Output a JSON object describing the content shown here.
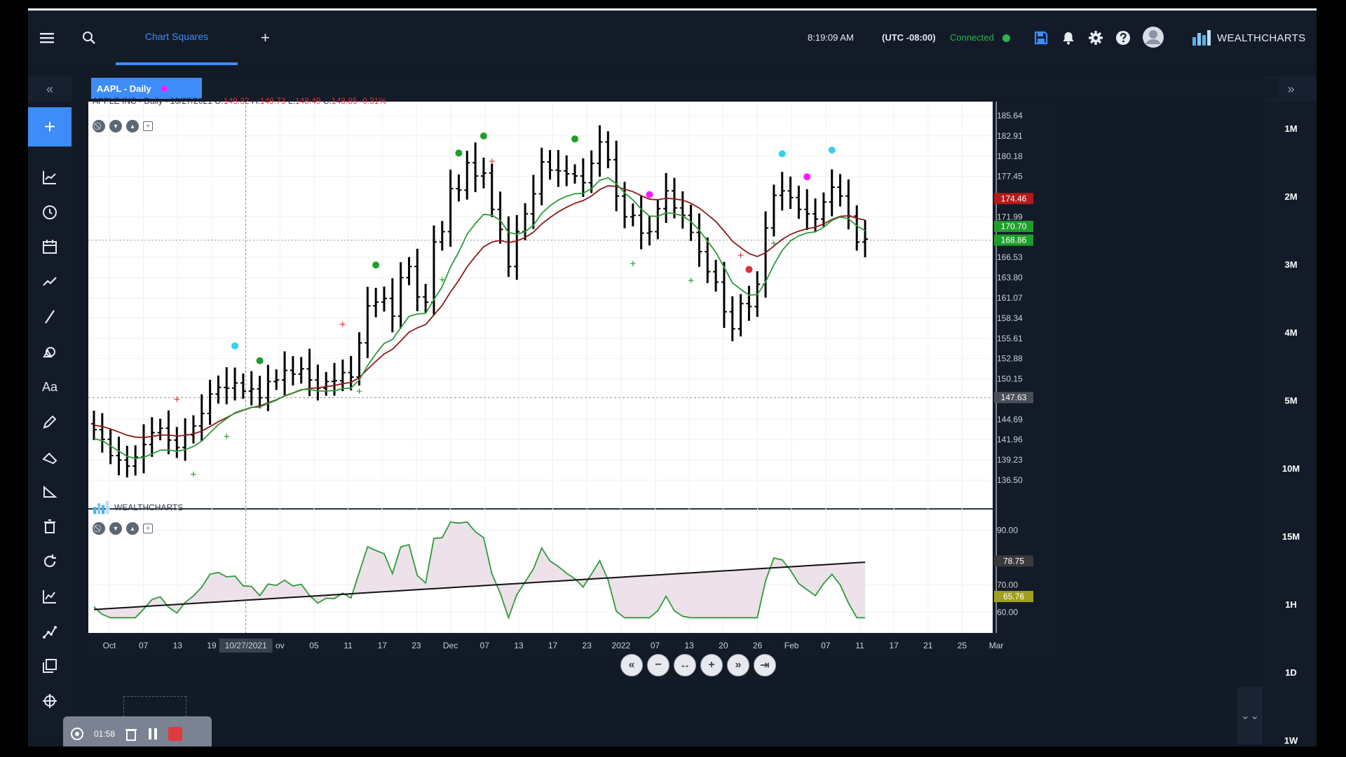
{
  "topbar": {
    "tab_label": "Chart Squares",
    "add_tab": "+",
    "time": "8:19:09 AM",
    "timezone": "(UTC -08:00)",
    "connection": "Connected",
    "brand": "WEALTHCHARTS"
  },
  "chart": {
    "symbol_tab": "AAPL - Daily",
    "ohlc": {
      "title": "APPLE INC - Daily - 10/27/2021",
      "o_label": "O:",
      "o": "149.32",
      "h_label": "H:",
      "h": "149.73",
      "l_label": "L:",
      "l": "148.49",
      "c_label": "C:",
      "c": "148.85",
      "change": "-0.31%"
    },
    "watermark": "WEALTHCHARTS",
    "crosshair_date": "10/27/2021",
    "colors": {
      "up_line": "#2e9b3a",
      "down_line": "#8b1a1a",
      "bars": "#000000",
      "price_box_red": "#b31b1b",
      "price_box_green": "#1f9e2b",
      "indicator_fill": "#e8d9e5",
      "indicator_neg_fill": "#f7c9cf"
    }
  },
  "chart_data": [
    {
      "type": "ohlc",
      "symbol": "AAPL",
      "price_axis_ticks": [
        "185.64",
        "182.91",
        "180.18",
        "177.45",
        "171.99",
        "166.53",
        "163.80",
        "161.07",
        "158.34",
        "155.61",
        "152.88",
        "150.15",
        "144.69",
        "141.96",
        "139.23",
        "136.50"
      ],
      "ylim": [
        136.5,
        185.64
      ],
      "price_labels": [
        {
          "value": "174.46",
          "color": "#b31b1b"
        },
        {
          "value": "170.70",
          "color": "#1f9e2b"
        },
        {
          "value": "168.86",
          "color": "#1f9e2b"
        },
        {
          "value": "147.63",
          "color": "#4a4f5a"
        }
      ],
      "x_ticks": [
        "Oct",
        "07",
        "13",
        "19",
        "10/27/2021",
        "ov",
        "05",
        "11",
        "17",
        "23",
        "Dec",
        "07",
        "13",
        "17",
        "23",
        "2022",
        "07",
        "13",
        "20",
        "26",
        "Feb",
        "07",
        "11",
        "17",
        "21",
        "25",
        "Mar"
      ],
      "series": [
        {
          "name": "close",
          "values": [
            143.3,
            142.0,
            139.8,
            139.2,
            138.4,
            139.6,
            141.3,
            142.9,
            143.5,
            141.9,
            140.9,
            142.6,
            143.8,
            145.5,
            148.1,
            149.0,
            148.9,
            149.6,
            148.5,
            148.8,
            147.6,
            149.8,
            150.0,
            151.3,
            150.8,
            151.5,
            150.0,
            148.9,
            149.8,
            149.9,
            151.0,
            150.4,
            155.0,
            160.0,
            160.5,
            161.0,
            158.6,
            163.8,
            165.3,
            161.2,
            160.5,
            168.6,
            170.0,
            175.8,
            175.6,
            179.3,
            177.5,
            177.9,
            173.0,
            170.3,
            165.3,
            170.0,
            172.4,
            175.1,
            179.4,
            178.3,
            178.2,
            177.8,
            177.5,
            176.6,
            179.2,
            182.1,
            179.7,
            174.8,
            172.0,
            172.2,
            169.8,
            170.0,
            173.1,
            175.5,
            173.2,
            172.2,
            169.9,
            167.3,
            164.6,
            163.2,
            159.2,
            156.9,
            160.3,
            159.9,
            162.9,
            170.5,
            174.9,
            175.5,
            174.6,
            173.0,
            172.4,
            171.7,
            174.0,
            176.0,
            174.8,
            172.1,
            168.6,
            169.0
          ]
        }
      ],
      "moving_averages": [
        "green EMA",
        "dark red EMA"
      ]
    },
    {
      "type": "line",
      "name": "indicator",
      "y_ticks": [
        "90.00",
        "70.00",
        "60.00"
      ],
      "ylim": [
        55,
        95
      ],
      "price_labels": [
        {
          "value": "78.75",
          "color": "#3a3a3a"
        },
        {
          "value": "65.76",
          "color": "#a0a020"
        }
      ]
    }
  ],
  "right_panel": {
    "timeframes": [
      "1M",
      "2M",
      "3M",
      "4M",
      "5M",
      "10M",
      "15M",
      "1H",
      "1D",
      "1W"
    ]
  },
  "recorder": {
    "time": "01:58"
  }
}
